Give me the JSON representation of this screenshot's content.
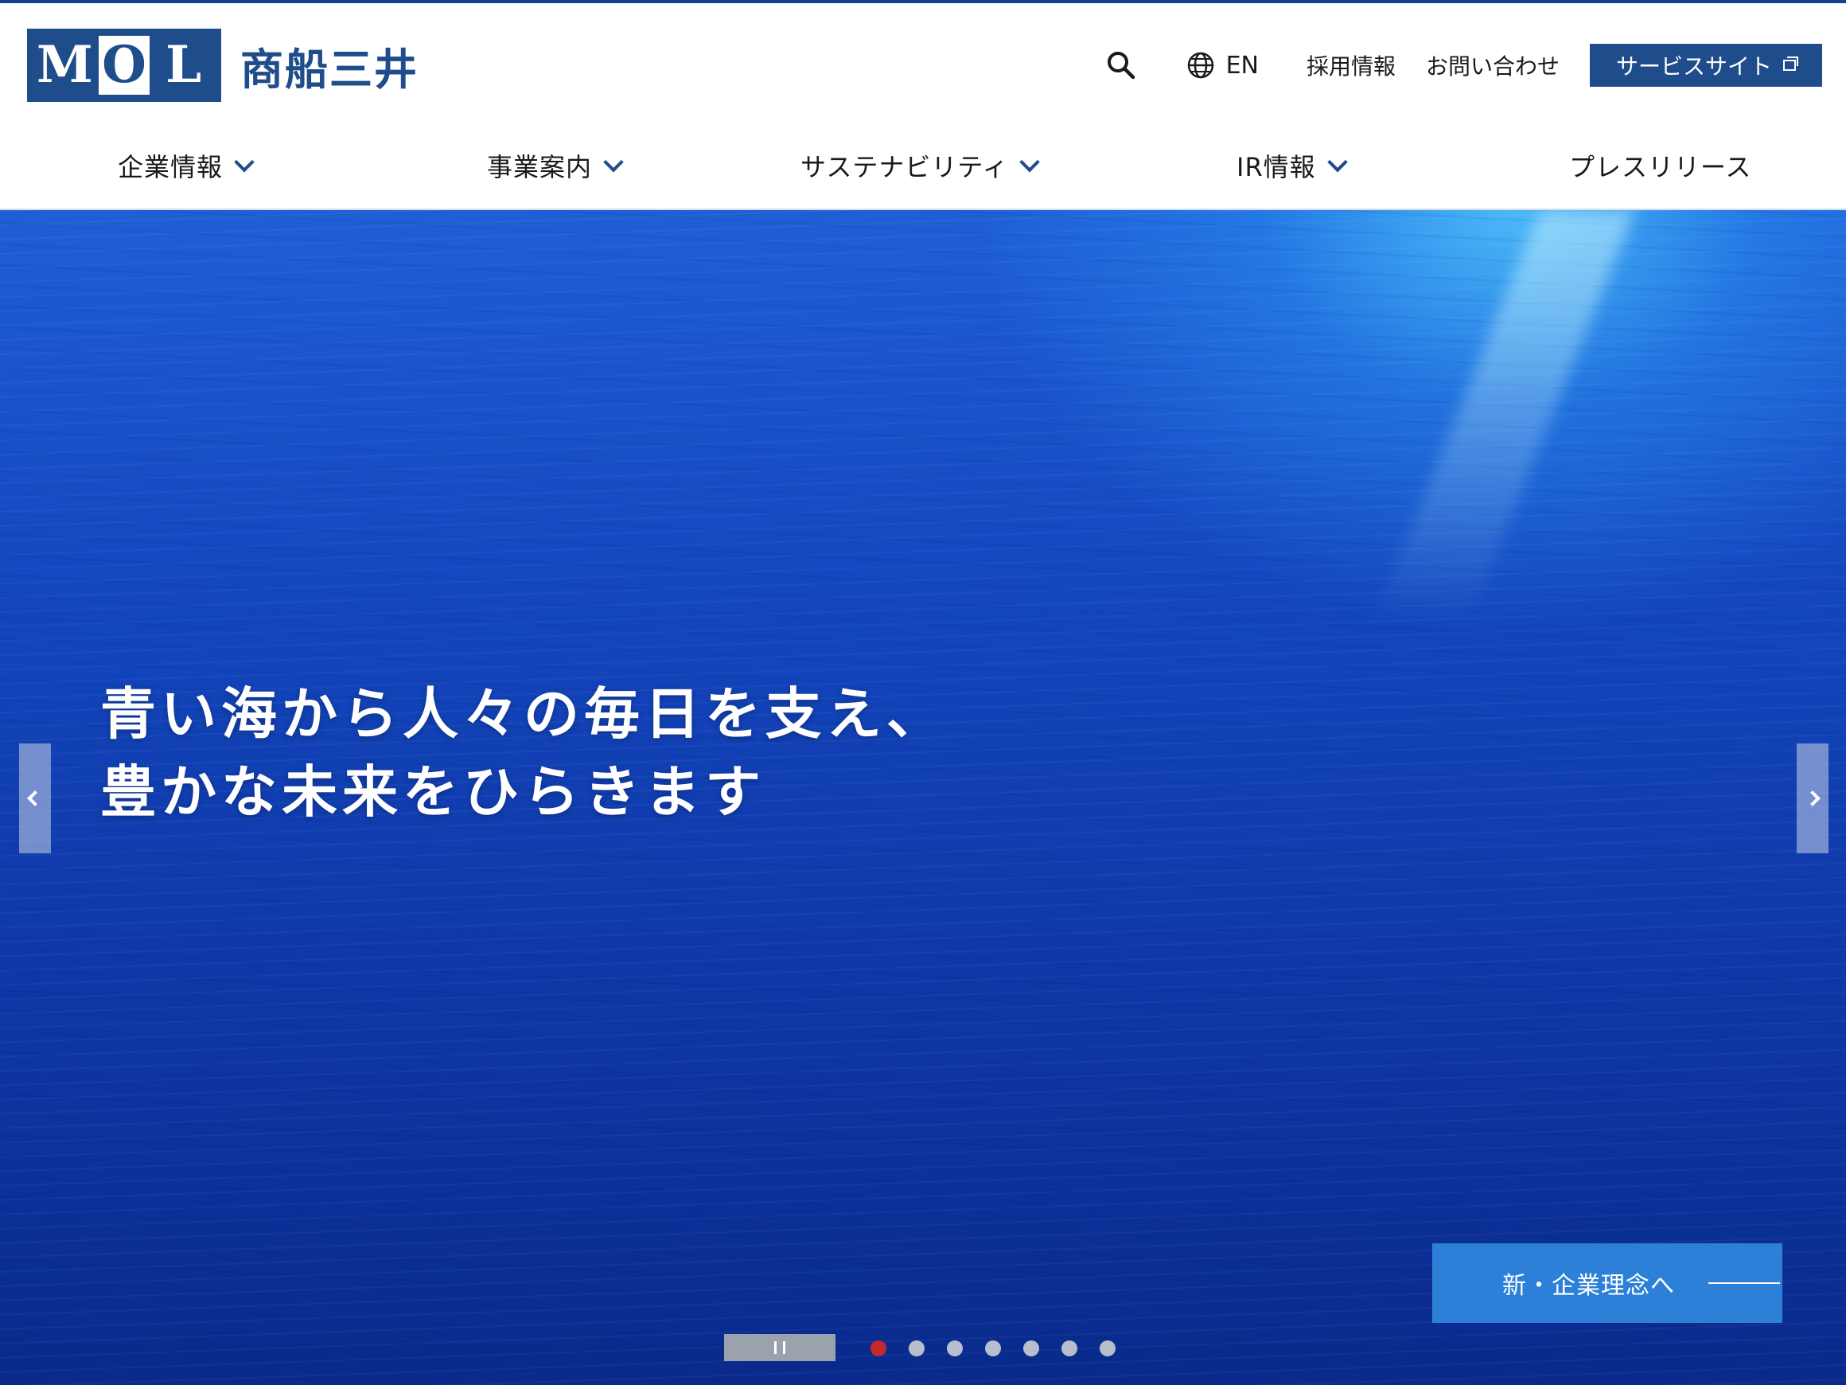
{
  "header": {
    "logo": {
      "letters": [
        "M",
        "O",
        "L"
      ],
      "name": "商船三井"
    },
    "util": {
      "lang_label": "EN",
      "careers": "採用情報",
      "contact": "お問い合わせ",
      "service_site": "サービスサイト"
    },
    "nav": [
      {
        "label": "企業情報",
        "dropdown": true
      },
      {
        "label": "事業案内",
        "dropdown": true
      },
      {
        "label": "サステナビリティ",
        "dropdown": true
      },
      {
        "label": "IR情報",
        "dropdown": true
      },
      {
        "label": "プレスリリース",
        "dropdown": false
      }
    ]
  },
  "hero": {
    "headline_line1": "青い海から人々の毎日を支え、",
    "headline_line2": "豊かな未来をひらきます",
    "cta_label": "新・企業理念へ",
    "slides_total": 7,
    "active_slide": 1
  },
  "colors": {
    "brand": "#1f4d8c",
    "cta": "#2d80d8",
    "active_dot": "#c3282a"
  },
  "icons": [
    "search-icon",
    "globe-icon",
    "external-link-icon",
    "chevron-down-icon",
    "chevron-left-icon",
    "chevron-right-icon",
    "pause-icon"
  ]
}
